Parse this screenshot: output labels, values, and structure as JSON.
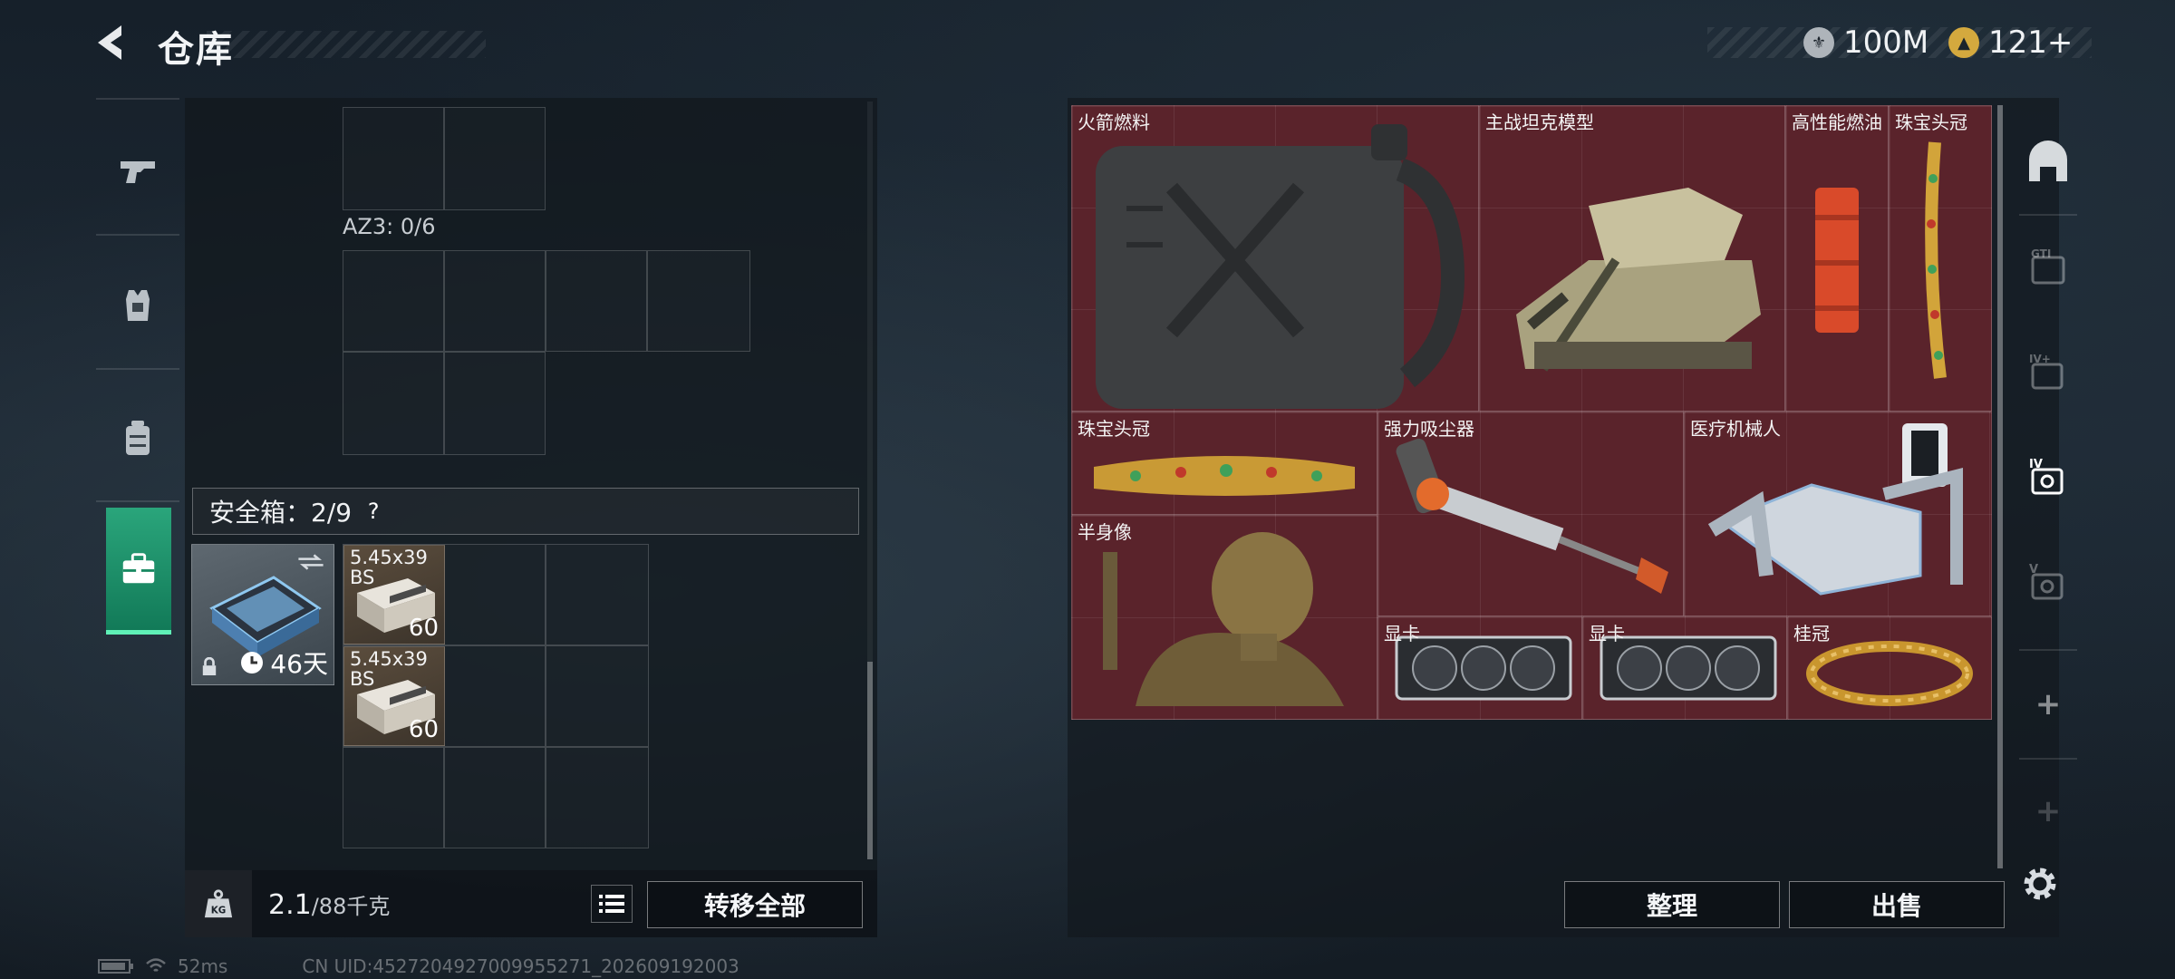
{
  "header": {
    "title": "仓库",
    "currency_silver": "100M",
    "currency_gold": "121+",
    "back_icon": "chevron-left-icon"
  },
  "side_tabs": [
    {
      "name": "weapons",
      "icon": "pistol-icon"
    },
    {
      "name": "armor",
      "icon": "vest-icon"
    },
    {
      "name": "backpack",
      "icon": "backpack-icon"
    },
    {
      "name": "safebox",
      "icon": "briefcase-icon",
      "active": true
    }
  ],
  "left_panel": {
    "az3_label": "AZ3: 0/6",
    "safebox_title": "安全箱：2/9",
    "safebox_help": "?",
    "safebox_item": {
      "days": "46天"
    },
    "ammo": [
      {
        "name": "5.45x39 BS",
        "qty": "60"
      },
      {
        "name": "5.45x39 BS",
        "qty": "60"
      }
    ],
    "weight_current": "2.1",
    "weight_max": "/88千克",
    "transfer_all": "转移全部"
  },
  "right_panel": {
    "items": [
      {
        "name": "火箭燃料",
        "kind": "fuel-can"
      },
      {
        "name": "主战坦克模型",
        "kind": "tank"
      },
      {
        "name": "高性能燃油",
        "kind": "fuel-tube"
      },
      {
        "name": "珠宝头冠",
        "kind": "crown-vertical"
      },
      {
        "name": "珠宝头冠",
        "kind": "crown"
      },
      {
        "name": "强力吸尘器",
        "kind": "vacuum"
      },
      {
        "name": "医疗机械人",
        "kind": "robot"
      },
      {
        "name": "半身像",
        "kind": "bust"
      },
      {
        "name": "显卡",
        "kind": "gpu"
      },
      {
        "name": "显卡",
        "kind": "gpu"
      },
      {
        "name": "桂冠",
        "kind": "laurel"
      }
    ],
    "sort_label": "整理",
    "sell_label": "出售",
    "categories": [
      {
        "label": "",
        "icon": "locker-icon"
      },
      {
        "label": "GTI",
        "icon": "case-gti-icon"
      },
      {
        "label": "IV+",
        "icon": "case-iv-plus-icon"
      },
      {
        "label": "IV",
        "icon": "case-iv-icon"
      },
      {
        "label": "V",
        "icon": "case-v-icon"
      },
      {
        "label": "+",
        "icon": "plus-icon"
      },
      {
        "label": "+",
        "icon": "plus-icon"
      }
    ]
  },
  "status": {
    "ping": "52ms",
    "uid": "CN UID:4527204927009955271_202609192003"
  },
  "colors": {
    "item_bg": "#5a232b",
    "accent_green": "#2aa57b",
    "ammo_bg": "#5b4d3d"
  }
}
